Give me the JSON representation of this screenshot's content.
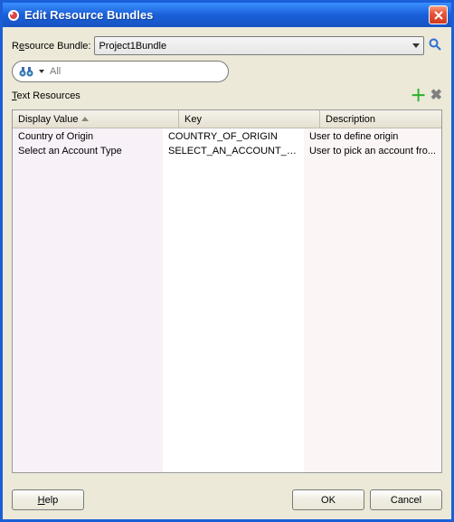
{
  "window": {
    "title": "Edit Resource Bundles"
  },
  "bundle": {
    "label_pre": "R",
    "label_u": "e",
    "label_post": "source Bundle:",
    "value": "Project1Bundle"
  },
  "search": {
    "placeholder": "All"
  },
  "section": {
    "title_u": "T",
    "title_post": "ext Resources"
  },
  "table": {
    "headers": {
      "display": "Display Value",
      "key": "Key",
      "description": "Description"
    },
    "rows": [
      {
        "display": "Country of Origin",
        "key": "COUNTRY_OF_ORIGIN",
        "description": "User to define origin"
      },
      {
        "display": "Select an Account Type",
        "key": "SELECT_AN_ACCOUNT_TYPE",
        "description": "User to pick an account fro..."
      }
    ]
  },
  "buttons": {
    "help_u": "H",
    "help_post": "elp",
    "ok": "OK",
    "cancel": "Cancel"
  }
}
